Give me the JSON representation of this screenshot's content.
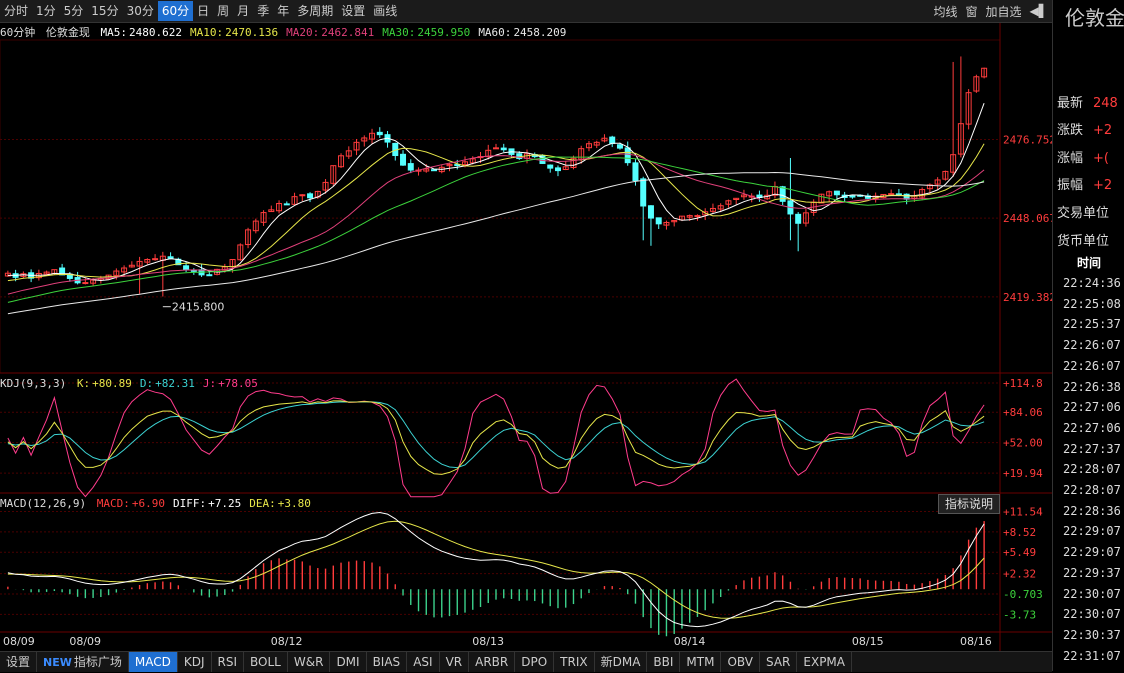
{
  "toolbar": {
    "periods": [
      "分时",
      "1分",
      "5分",
      "15分",
      "30分",
      "60分",
      "日",
      "周",
      "月",
      "季",
      "年",
      "多周期",
      "设置",
      "画线"
    ],
    "active_period": "60分",
    "right": [
      "均线",
      "窗",
      "加自选"
    ]
  },
  "ma_line": {
    "period": "60分钟",
    "name": "伦敦金现",
    "items": [
      {
        "label": "MA5:",
        "value": "2480.622",
        "color": "#ffffff"
      },
      {
        "label": "MA10:",
        "value": "2470.136",
        "color": "#e6e64a"
      },
      {
        "label": "MA20:",
        "value": "2462.841",
        "color": "#e0407a"
      },
      {
        "label": "MA30:",
        "value": "2459.950",
        "color": "#3cd23c"
      },
      {
        "label": "MA60:",
        "value": "2458.209",
        "color": "#e8e8e8"
      }
    ]
  },
  "kdj_label": {
    "title": "KDJ(9,3,3)",
    "items": [
      {
        "label": "K:",
        "value": "+80.89",
        "color": "#e6e64a"
      },
      {
        "label": "D:",
        "value": "+82.31",
        "color": "#3cd2d2"
      },
      {
        "label": "J:",
        "value": "+78.05",
        "color": "#ff3c8c"
      }
    ]
  },
  "macd_label": {
    "title": "MACD(12,26,9)",
    "items": [
      {
        "label": "MACD:",
        "value": "+6.90",
        "color": "#ff3c3c"
      },
      {
        "label": "DIFF:",
        "value": "+7.25",
        "color": "#ffffff"
      },
      {
        "label": "DEA:",
        "value": "+3.80",
        "color": "#e6e64a"
      }
    ]
  },
  "indicator_explain": "指标说明",
  "bottom_tabs": [
    "设置",
    "指标广场",
    "MACD",
    "KDJ",
    "RSI",
    "BOLL",
    "W&R",
    "DMI",
    "BIAS",
    "ASI",
    "VR",
    "ARBR",
    "DPO",
    "TRIX",
    "新DMA",
    "BBI",
    "MTM",
    "OBV",
    "SAR",
    "EXPMA"
  ],
  "bottom_new_badge": "NEW",
  "active_tab": "MACD",
  "right_panel": {
    "title": "伦敦金",
    "rows": [
      {
        "label": "最新",
        "value": "248"
      },
      {
        "label": "涨跌",
        "value": "+2"
      },
      {
        "label": "涨幅",
        "value": "+("
      },
      {
        "label": "振幅",
        "value": "+2"
      },
      {
        "label": "交易单位",
        "value": ""
      },
      {
        "label": "货币单位",
        "value": ""
      }
    ],
    "time_header": "时间",
    "times": [
      "22:24:36",
      "22:25:08",
      "22:25:37",
      "22:26:07",
      "22:26:07",
      "22:26:38",
      "22:27:06",
      "22:27:06",
      "22:27:37",
      "22:28:07",
      "22:28:07",
      "22:28:36",
      "22:29:07",
      "22:29:07",
      "22:29:37",
      "22:30:07",
      "22:30:07",
      "22:30:37",
      "22:31:07"
    ]
  },
  "chart_data": [
    {
      "type": "candlestick",
      "title": "60分钟 伦敦金现",
      "y_ticks": [
        "2476.752",
        "2448.067",
        "2419.382"
      ],
      "ylim": [
        2392,
        2513
      ],
      "low_annotation": "2415.800",
      "x_labels": [
        "08/09",
        "08/09",
        "08/12",
        "08/13",
        "08/14",
        "08/15",
        "08/16"
      ],
      "close": [
        2428.0,
        2426.5,
        2427.8,
        2426.2,
        2427.9,
        2428.4,
        2429.3,
        2427.4,
        2426.1,
        2424.5,
        2424.6,
        2425.5,
        2426.1,
        2427.3,
        2428.8,
        2429.9,
        2430.9,
        2432.3,
        2433.0,
        2433.3,
        2434.2,
        2433.4,
        2431.1,
        2429.2,
        2428.7,
        2427.4,
        2427.4,
        2429.4,
        2430.3,
        2433.0,
        2438.3,
        2443.8,
        2447.0,
        2450.1,
        2451.1,
        2453.4,
        2453.1,
        2455.9,
        2456.6,
        2455.5,
        2457.8,
        2461.1,
        2467.2,
        2470.8,
        2472.6,
        2475.7,
        2477.3,
        2479.0,
        2478.5,
        2475.8,
        2470.9,
        2467.4,
        2465.6,
        2465.6,
        2466.0,
        2465.4,
        2466.6,
        2467.6,
        2467.4,
        2468.6,
        2469.7,
        2470.5,
        2472.8,
        2473.7,
        2473.0,
        2471.3,
        2469.8,
        2471.5,
        2470.5,
        2468.0,
        2466.3,
        2465.4,
        2466.8,
        2469.9,
        2473.4,
        2475.2,
        2475.7,
        2477.2,
        2475.3,
        2473.6,
        2468.3,
        2461.8,
        2452.5,
        2448.1,
        2446.0,
        2446.5,
        2447.2,
        2448.8,
        2449.0,
        2449.0,
        2450.4,
        2451.6,
        2452.6,
        2454.4,
        2455.3,
        2456.5,
        2456.1,
        2455.6,
        2456.4,
        2459.6,
        2454.2,
        2449.6,
        2446.2,
        2450.0,
        2453.9,
        2456.8,
        2457.7,
        2456.6,
        2455.6,
        2456.1,
        2456.4,
        2455.3,
        2456.1,
        2456.7,
        2457.0,
        2456.6,
        2455.0,
        2456.1,
        2458.5,
        2460.2,
        2462.0,
        2465.1,
        2471.2,
        2482.5,
        2493.8,
        2499.6,
        2502.7
      ],
      "series": [
        {
          "name": "MA5",
          "color": "#ffffff"
        },
        {
          "name": "MA10",
          "color": "#e6e64a"
        },
        {
          "name": "MA20",
          "color": "#e0407a"
        },
        {
          "name": "MA30",
          "color": "#3cd23c"
        },
        {
          "name": "MA60",
          "color": "#e8e8e8"
        }
      ]
    },
    {
      "type": "line",
      "title": "KDJ(9,3,3)",
      "y_ticks": [
        "+114.8",
        "+84.06",
        "+52.00",
        "+19.94"
      ],
      "ylim": [
        0,
        118
      ],
      "series": [
        {
          "name": "K",
          "color": "#e6e64a"
        },
        {
          "name": "D",
          "color": "#3cd2d2"
        },
        {
          "name": "J",
          "color": "#ff3c8c"
        }
      ]
    },
    {
      "type": "bar",
      "title": "MACD(12,26,9)",
      "y_ticks": [
        "+11.54",
        "+8.52",
        "+5.49",
        "+2.32",
        "-0.703",
        "-3.73"
      ],
      "ylim": [
        -6.2,
        12.5
      ],
      "series": [
        {
          "name": "DIFF",
          "color": "#ffffff"
        },
        {
          "name": "DEA",
          "color": "#e6e64a"
        },
        {
          "name": "MACD",
          "color": "#ff3c3c"
        }
      ]
    }
  ]
}
